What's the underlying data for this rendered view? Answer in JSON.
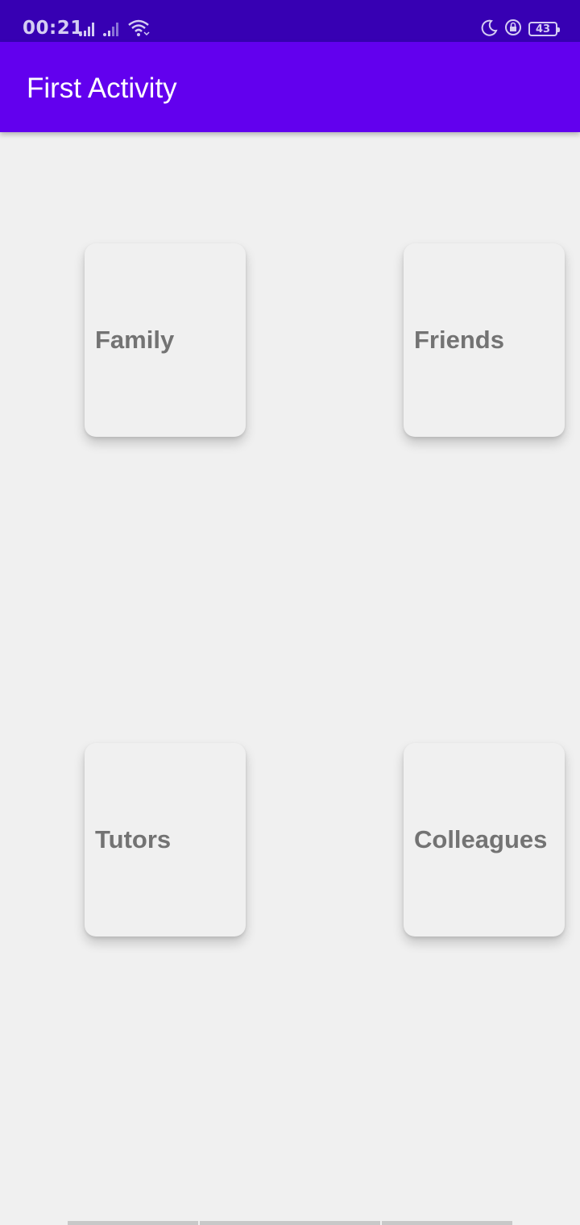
{
  "status_bar": {
    "time": "00:21",
    "battery_level": "43",
    "icons": [
      "signal-icon",
      "signal-icon",
      "wifi-icon",
      "moon-icon",
      "rotation-lock-icon",
      "battery-icon"
    ]
  },
  "app_bar": {
    "title": "First Activity",
    "color": "#6200ee",
    "status_color": "#3700b3"
  },
  "cards": [
    {
      "label": "Family"
    },
    {
      "label": "Friends"
    },
    {
      "label": "Tutors"
    },
    {
      "label": "Colleagues"
    }
  ]
}
